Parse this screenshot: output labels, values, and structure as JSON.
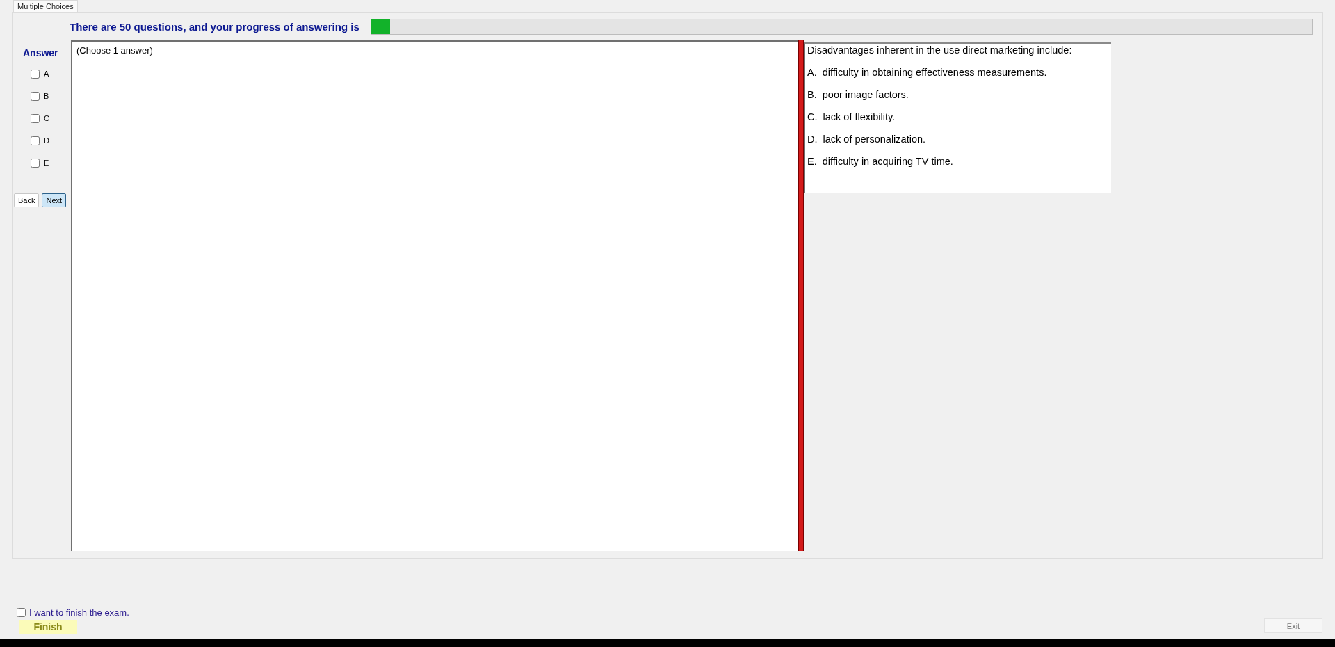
{
  "tab": {
    "label": "Multiple Choices",
    "selected": true
  },
  "header": {
    "text": "There are 50 questions, and your progress of answering is",
    "progress": {
      "level": 0.02
    }
  },
  "answer": {
    "title": "Answer",
    "options": [
      {
        "label": "A",
        "checked": false
      },
      {
        "label": "B",
        "checked": false
      },
      {
        "label": "C",
        "checked": false
      },
      {
        "label": "D",
        "checked": false
      },
      {
        "label": "E",
        "checked": false
      }
    ]
  },
  "nav_buttons": [
    {
      "label": "Back",
      "default": false
    },
    {
      "label": "Next",
      "default": true
    }
  ],
  "instruction": "(Choose 1 answer)",
  "question": {
    "text": "Disadvantages inherent in the use direct marketing include:",
    "choices": [
      "A.  difficulty in obtaining effectiveness measurements.",
      "B.  poor image factors.",
      "C.  lack of flexibility.",
      "D.  lack of personalization.",
      "E.  difficulty in acquiring TV time."
    ]
  },
  "finish": {
    "checkbox": {
      "label": "I want to finish the exam.",
      "checked": false
    },
    "button": "Finish"
  },
  "exit_button": {
    "label": "Exit",
    "disabled": true
  }
}
